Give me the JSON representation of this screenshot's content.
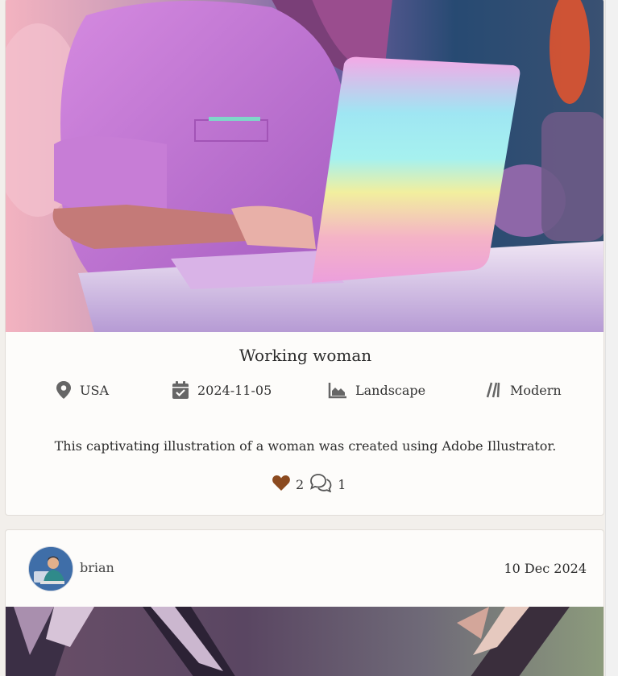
{
  "post1": {
    "title": "Working woman",
    "meta": {
      "location": "USA",
      "date": "2024-11-05",
      "orientation": "Landscape",
      "style": "Modern"
    },
    "description": "This captivating illustration of a woman was created using Adobe Illustrator.",
    "likes": "2",
    "comments": "1",
    "icons": [
      "location-pin-icon",
      "calendar-icon",
      "landscape-icon",
      "style-lines-icon",
      "heart-icon",
      "comments-icon"
    ]
  },
  "post2": {
    "username": "brian",
    "date": "10 Dec 2024"
  },
  "colors": {
    "page_bg": "#f2efeb",
    "card_bg": "#fdfcfa",
    "heart": "#8b4a1f",
    "icon_gray": "#666666"
  }
}
